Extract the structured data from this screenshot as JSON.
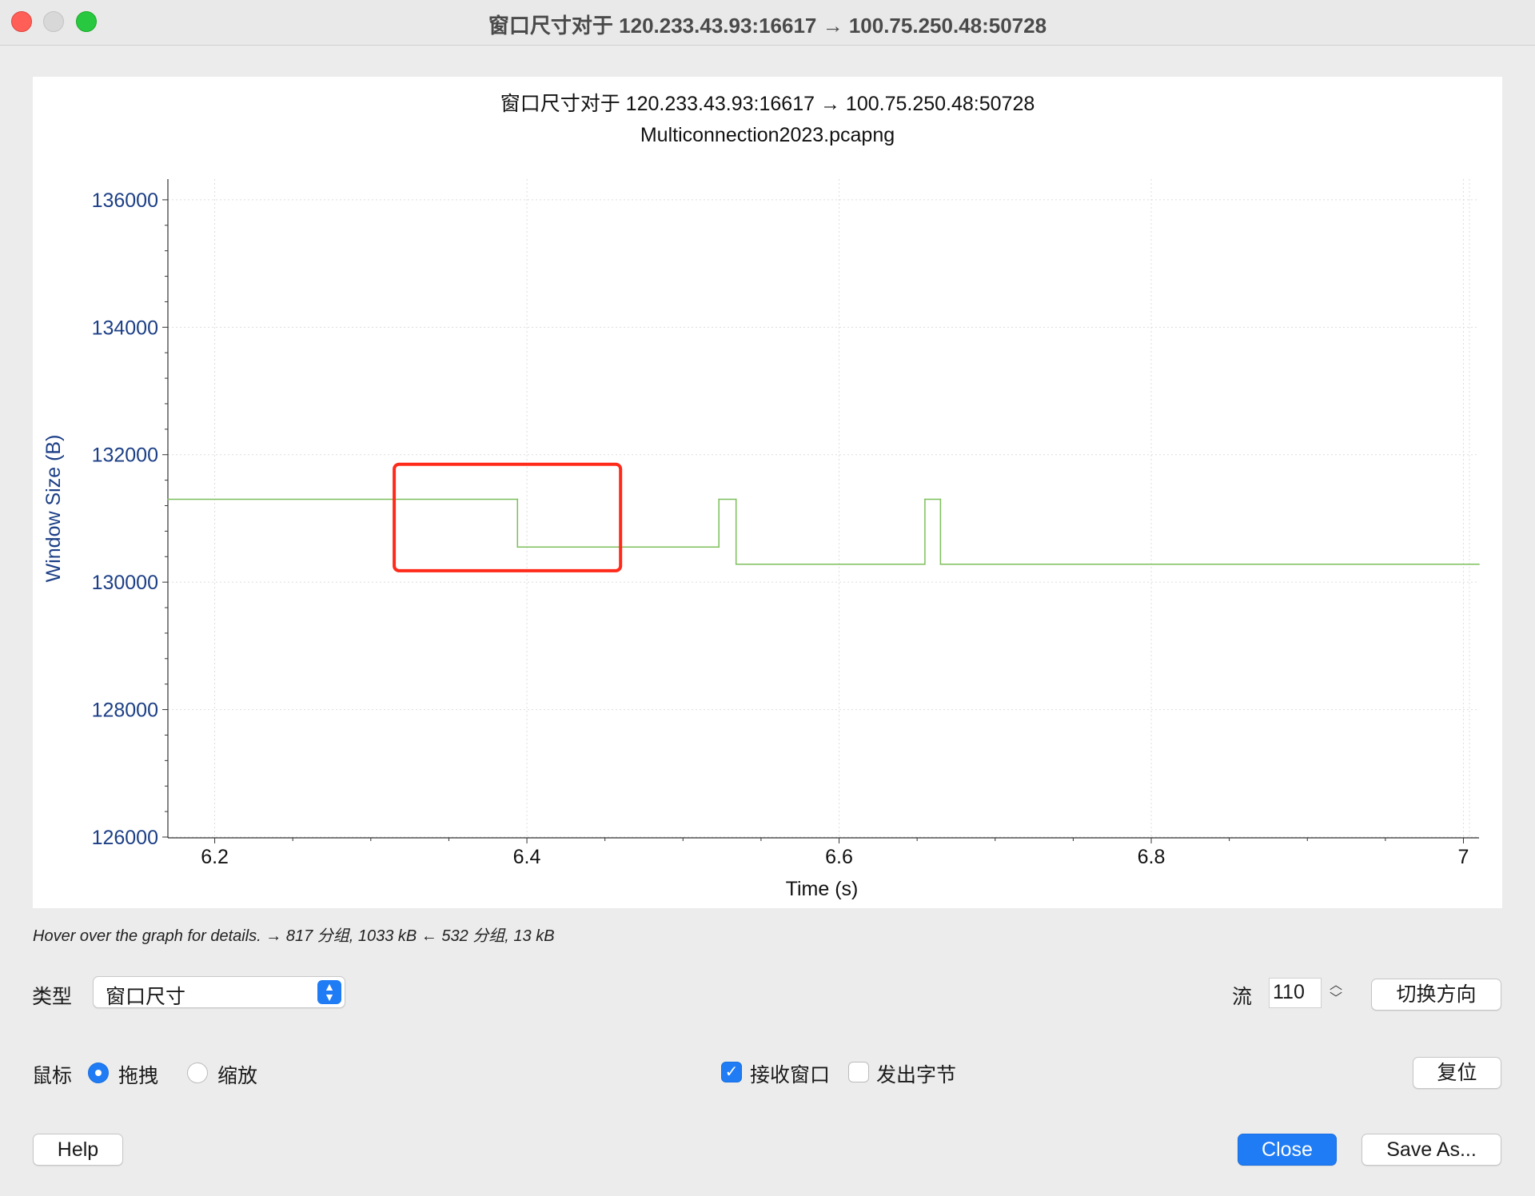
{
  "window": {
    "title": "窗口尺寸对于 120.233.43.93:16617 → 100.75.250.48:50728"
  },
  "chart_data": {
    "type": "line",
    "step": true,
    "title": "窗口尺寸对于 120.233.43.93:16617 → 100.75.250.48:50728",
    "subtitle": "Multiconnection2023.pcapng",
    "xlabel": "Time (s)",
    "ylabel": "Window Size (B)",
    "xlim": [
      6.17,
      7.01
    ],
    "ylim": [
      126000,
      136300
    ],
    "x_ticks": [
      "6.2",
      "6.4",
      "6.6",
      "6.8",
      "7"
    ],
    "y_ticks": [
      "136000",
      "134000",
      "132000",
      "130000",
      "128000",
      "126000"
    ],
    "grid": true,
    "series": [
      {
        "color": "#7cbf5a",
        "x": [
          6.17,
          6.394,
          6.394,
          6.523,
          6.523,
          6.534,
          6.534,
          6.655,
          6.655,
          6.665,
          6.665,
          7.01
        ],
        "y": [
          131300,
          131300,
          130550,
          130550,
          131300,
          131300,
          130280,
          130280,
          131300,
          131300,
          130280,
          130280
        ]
      }
    ],
    "highlight_box": {
      "color": "#ff2a1a",
      "x_range": [
        6.315,
        6.46
      ],
      "y_range": [
        130180,
        131850
      ]
    }
  },
  "status": {
    "hint": "Hover over the graph for details. → 817 分组, 1033 kB ← 532 分组, 13 kB"
  },
  "controls": {
    "type_label": "类型",
    "type_value": "窗口尺寸",
    "stream_label": "流",
    "stream_value": "110",
    "switch_direction": "切换方向",
    "mouse_label": "鼠标",
    "drag_label": "拖拽",
    "drag_selected": true,
    "zoom_label": "缩放",
    "zoom_selected": false,
    "rcv_window_label": "接收窗口",
    "rcv_window_checked": true,
    "bytes_out_label": "发出字节",
    "bytes_out_checked": false,
    "reset_label": "复位"
  },
  "footer": {
    "help": "Help",
    "close": "Close",
    "save_as": "Save As..."
  }
}
